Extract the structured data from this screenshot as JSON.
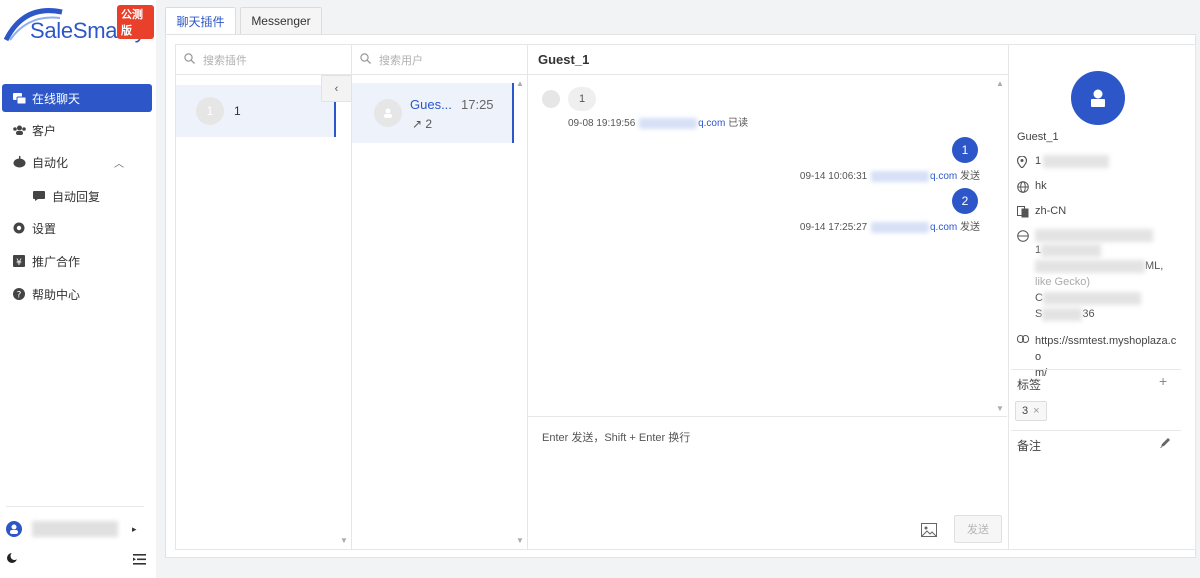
{
  "app": {
    "logo_text": "SaleSmartly",
    "beta_badge": "公测版",
    "brand_color": "#2d57c8"
  },
  "sidebar": {
    "items": [
      {
        "label": "在线聊天",
        "icon": "chat-bubbles-icon",
        "active": true
      },
      {
        "label": "客户",
        "icon": "users-icon"
      },
      {
        "label": "自动化",
        "icon": "robot-icon"
      },
      {
        "label": "自动回复",
        "icon": "message-icon"
      },
      {
        "label": "设置",
        "icon": "gear-icon"
      },
      {
        "label": "推广合作",
        "icon": "yen-icon"
      },
      {
        "label": "帮助中心",
        "icon": "help-icon"
      }
    ],
    "user_arrow": "▸"
  },
  "tabs": [
    {
      "label": "聊天插件",
      "active": true
    },
    {
      "label": "Messenger",
      "active": false
    }
  ],
  "plugins": {
    "search_placeholder": "搜索插件",
    "items": [
      {
        "name": "1",
        "avatar_text": "1"
      }
    ]
  },
  "users": {
    "search_placeholder": "搜索用户",
    "items": [
      {
        "name": "Gues...",
        "time": "17:25",
        "count": "↗ 2"
      }
    ]
  },
  "chat": {
    "title": "Guest_1",
    "messages": [
      {
        "direction": "in",
        "text": "1",
        "time": "09-08 19:19:56",
        "email_suffix": "q.com",
        "status": "已读"
      },
      {
        "direction": "out",
        "text": "1",
        "time": "09-14 10:06:31",
        "email_suffix": "q.com",
        "status": "发送"
      },
      {
        "direction": "out",
        "text": "2",
        "time": "09-14 17:25:27",
        "email_suffix": "q.com",
        "status": "发送"
      }
    ],
    "composer_placeholder": "Enter 发送，Shift + Enter 换行",
    "send_label": "发送"
  },
  "profile": {
    "name": "Guest_1",
    "location_prefix": "1",
    "region": "hk",
    "language": "zh-CN",
    "ua_fragments": [
      "1",
      "ML,",
      "like Gecko)",
      "C",
      "S",
      "36"
    ],
    "url": "https://ssmtest.myshoplaza.co",
    "url_end": "m/",
    "tags_label": "标签",
    "tags_add": "+",
    "tags": [
      {
        "label": "3",
        "remove": "×"
      }
    ],
    "notes_label": "备注"
  }
}
